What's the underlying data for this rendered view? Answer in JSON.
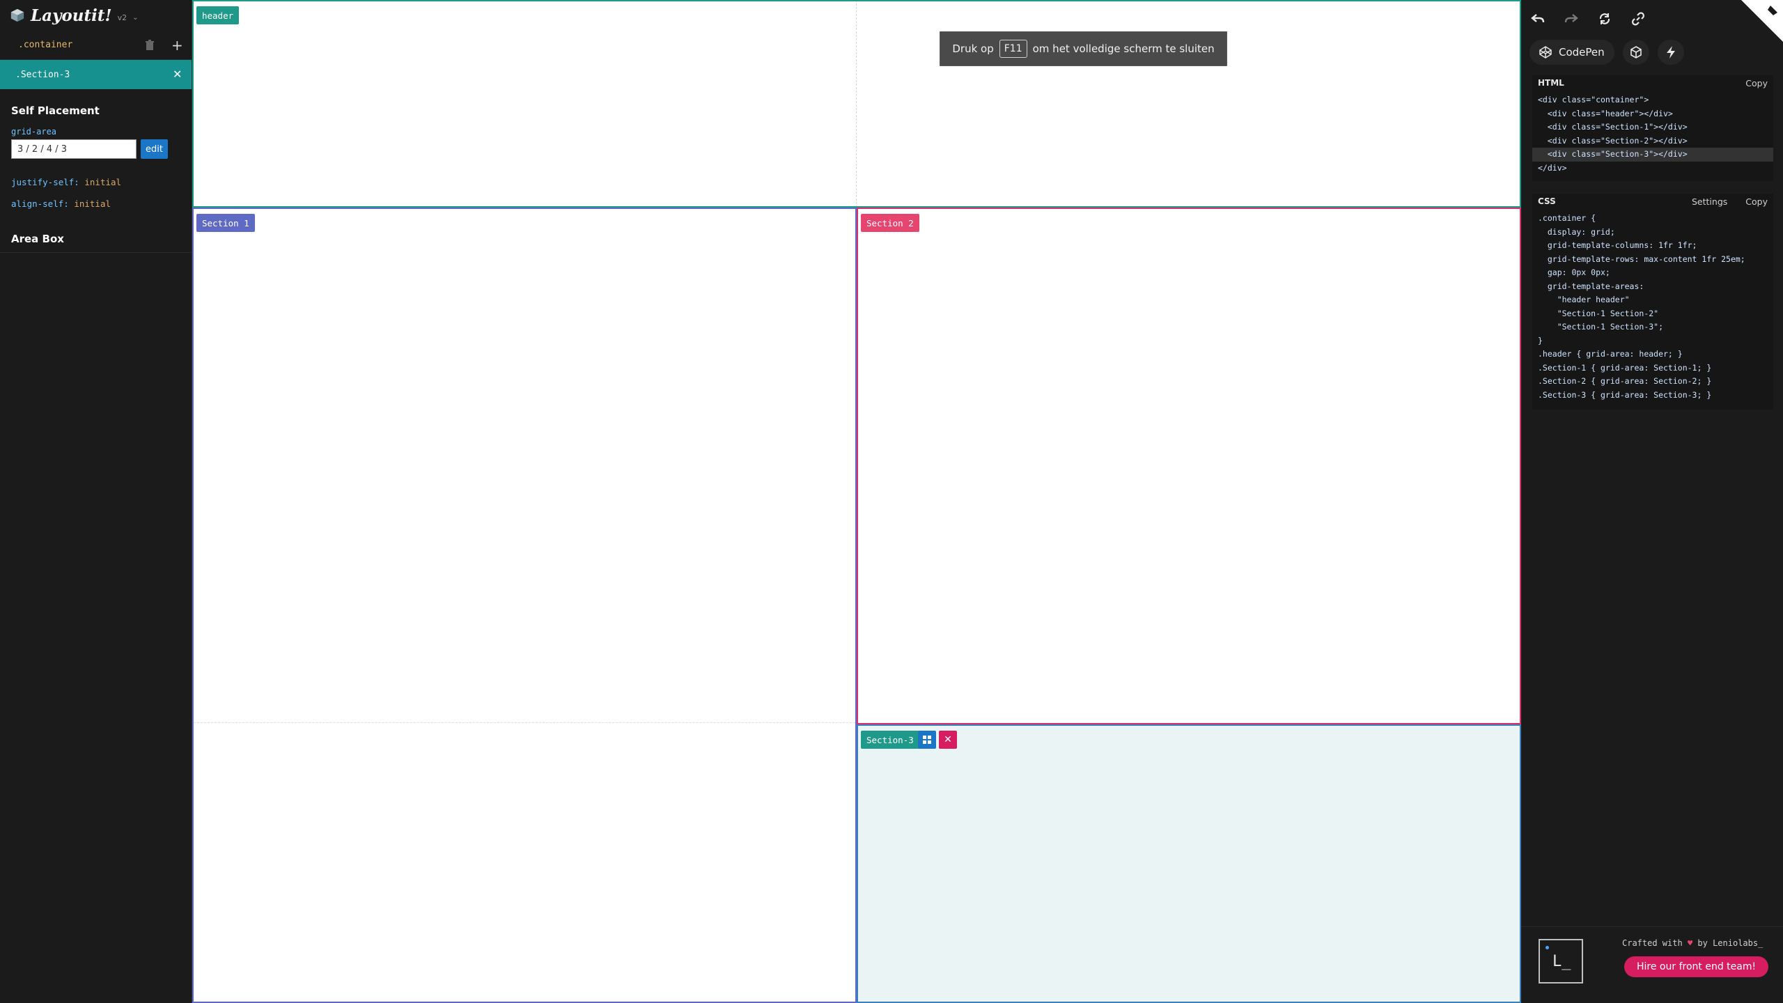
{
  "app": {
    "name": "Layoutit!",
    "version": "v2"
  },
  "left": {
    "tree": {
      "container_label": ".container",
      "selected_label": ".Section-3"
    },
    "self_placement": {
      "title": "Self Placement",
      "grid_area_label": "grid-area",
      "grid_area_value": "3 / 2 / 4 / 3",
      "edit_label": "edit",
      "justify_key": "justify-self:",
      "justify_val": "initial",
      "align_key": "align-self:",
      "align_val": "initial"
    },
    "area_box_title": "Area Box"
  },
  "canvas": {
    "cells": {
      "header": "header",
      "section1": "Section 1",
      "section2": "Section 2",
      "section3": "Section-3"
    },
    "toast": {
      "before": "Druk op",
      "key": "F11",
      "after": "om het volledige scherm te sluiten"
    }
  },
  "right": {
    "codepen_label": "CodePen",
    "html_panel": {
      "title": "HTML",
      "copy": "Copy",
      "lines": [
        "<div class=\"container\">",
        "  <div class=\"header\"></div>",
        "  <div class=\"Section-1\"></div>",
        "  <div class=\"Section-2\"></div>",
        "  <div class=\"Section-3\"></div>",
        "</div>"
      ]
    },
    "css_panel": {
      "title": "CSS",
      "settings": "Settings",
      "copy": "Copy",
      "lines": [
        ".container {",
        "  display: grid;",
        "  grid-template-columns: 1fr 1fr;",
        "  grid-template-rows: max-content 1fr 25em;",
        "  gap: 0px 0px;",
        "  grid-template-areas:",
        "    \"header header\"",
        "    \"Section-1 Section-2\"",
        "    \"Section-1 Section-3\";",
        "}",
        ".header { grid-area: header; }",
        ".Section-1 { grid-area: Section-1; }",
        ".Section-2 { grid-area: Section-2; }",
        ".Section-3 { grid-area: Section-3; }"
      ]
    },
    "footer": {
      "crafted_prefix": "Crafted with",
      "crafted_suffix": "by Leniolabs_",
      "hire_label": "Hire our front end team!"
    }
  },
  "colors": {
    "header": "#1f9a8a",
    "section1": "#5f6ac5",
    "section2": "#e6456f",
    "section3": "#1f9a8a",
    "accent": "#d61d5f"
  }
}
